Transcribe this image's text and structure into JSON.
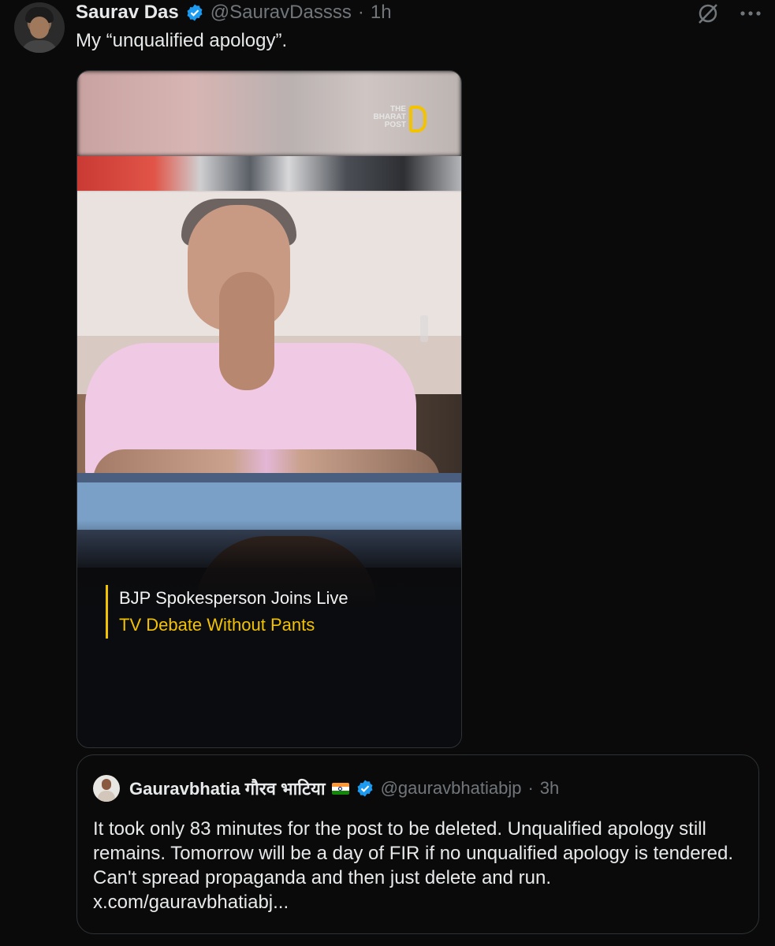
{
  "tweet": {
    "author_name": "Saurav Das",
    "handle": "@SauravDassss",
    "separator": "·",
    "time": "1h",
    "text": "My “unqualified apology”.",
    "media": {
      "logo_text": "THE BHARAT POST",
      "caption_line1": "BJP Spokesperson Joins Live",
      "caption_line2": "TV Debate Without Pants"
    }
  },
  "quoted": {
    "author_name": "Gauravbhatia गौरव भाटिया",
    "handle": "@gauravbhatiabjp",
    "separator": "·",
    "time": "3h",
    "text": "It took only 83 minutes for the post to be deleted. Unqualified apology still remains. Tomorrow will be a day of FIR if no unqualified apology is tendered. Can't spread propaganda and then just delete and run. x.com/gauravbhatiabj..."
  },
  "icons": {
    "verified": "verified-badge-icon",
    "grok": "grok-icon",
    "more": "more-icon",
    "flag": "india-flag-icon"
  },
  "colors": {
    "background": "#0a0a0a",
    "text": "#e7e9ea",
    "muted": "#71767b",
    "verified": "#1d9bf0",
    "caption_accent": "#f3c200"
  }
}
